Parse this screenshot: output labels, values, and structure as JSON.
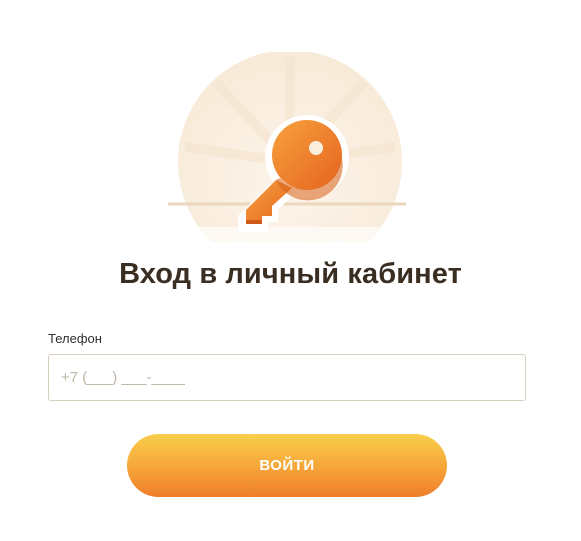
{
  "login": {
    "title": "Вход в личный кабинет",
    "phone_label": "Телефон",
    "phone_placeholder": "+7 (___) ___-____",
    "phone_value": "",
    "submit_label": "ВОЙТИ"
  },
  "illustration": {
    "icon": "key-icon",
    "colors": {
      "key": "#f08a2e",
      "key_shadow": "#d9651c",
      "background_disc": "#fbf1e3",
      "button_gradient_top": "#f9cf4b",
      "button_gradient_bottom": "#ef7e2b"
    }
  }
}
